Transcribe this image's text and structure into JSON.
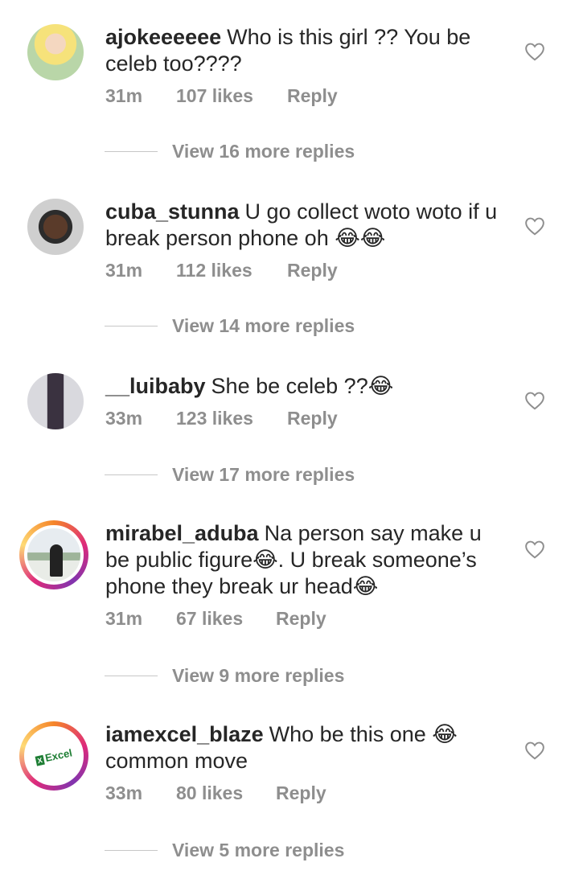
{
  "comments": [
    {
      "username": "ajokeeeeee",
      "text": "Who is this girl ?? You be celeb too????",
      "time": "31m",
      "likes": "107 likes",
      "reply": "Reply",
      "view_replies": "View 16 more replies",
      "avatar_ring": false
    },
    {
      "username": "cuba_stunna",
      "text": "U go collect woto woto if u break person phone oh 😂😂",
      "time": "31m",
      "likes": "112 likes",
      "reply": "Reply",
      "view_replies": "View 14 more replies",
      "avatar_ring": false
    },
    {
      "username": "__luibaby",
      "text": "She be celeb ??😂",
      "time": "33m",
      "likes": "123 likes",
      "reply": "Reply",
      "view_replies": "View 17 more replies",
      "avatar_ring": false
    },
    {
      "username": "mirabel_aduba",
      "text": "Na person say make u be public figure😂. U break someone’s phone they break ur head😂",
      "time": "31m",
      "likes": "67 likes",
      "reply": "Reply",
      "view_replies": "View 9 more replies",
      "avatar_ring": true
    },
    {
      "username": "iamexcel_blaze",
      "text": "Who be this one 😂 common move",
      "time": "33m",
      "likes": "80 likes",
      "reply": "Reply",
      "view_replies": "View 5 more replies",
      "avatar_ring": true,
      "avatar_logo_text": "Excel"
    }
  ],
  "icons": {
    "like": "heart-outline-icon"
  },
  "colors": {
    "text": "#262626",
    "secondary": "#8e8e8e",
    "divider": "#c7c7c7"
  }
}
